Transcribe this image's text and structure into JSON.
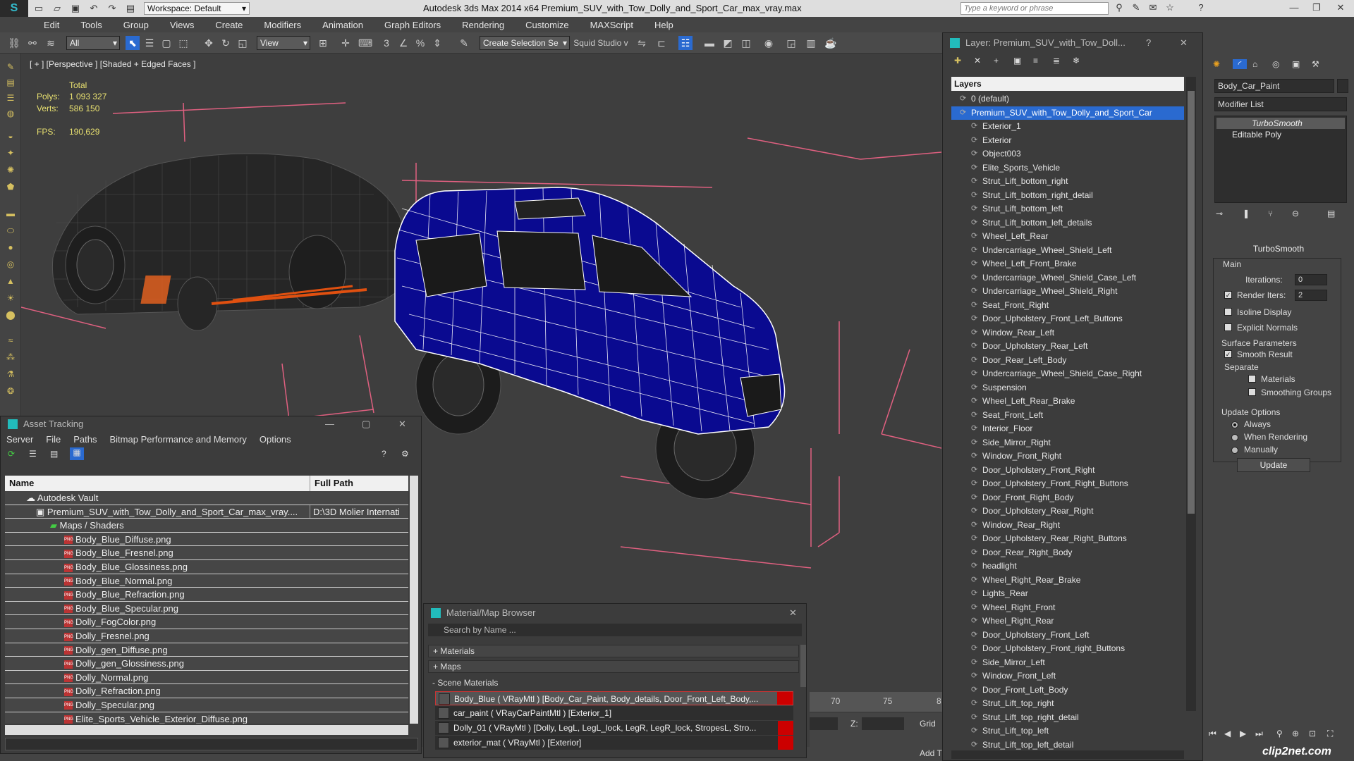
{
  "app": {
    "title": "Autodesk 3ds Max  2014 x64     Premium_SUV_with_Tow_Dolly_and_Sport_Car_max_vray.max",
    "workspace": "Workspace: Default",
    "search_placeholder": "Type a keyword or phrase"
  },
  "menu": [
    "Edit",
    "Tools",
    "Group",
    "Views",
    "Create",
    "Modifiers",
    "Animation",
    "Graph Editors",
    "Rendering",
    "Customize",
    "MAXScript",
    "Help"
  ],
  "toolbar": {
    "filter": "All",
    "refcoord": "View",
    "selection_set": "Create Selection Se",
    "squid": "Squid Studio v"
  },
  "viewport": {
    "label": "[ + ] [Perspective ] [Shaded + Edged Faces ]",
    "stats_header": "Total",
    "polys_label": "Polys:",
    "polys": "1 093 327",
    "verts_label": "Verts:",
    "verts": "586 150",
    "fps_label": "FPS:",
    "fps": "190,629"
  },
  "asset_tracking": {
    "title": "Asset Tracking",
    "menu": [
      "Server",
      "File",
      "Paths",
      "Bitmap Performance and Memory",
      "Options"
    ],
    "col_name": "Name",
    "col_path": "Full Path",
    "vault": "Autodesk Vault",
    "file": "Premium_SUV_with_Tow_Dolly_and_Sport_Car_max_vray....",
    "file_path": "D:\\3D Molier Internati",
    "group": "Maps / Shaders",
    "maps": [
      "Body_Blue_Diffuse.png",
      "Body_Blue_Fresnel.png",
      "Body_Blue_Glossiness.png",
      "Body_Blue_Normal.png",
      "Body_Blue_Refraction.png",
      "Body_Blue_Specular.png",
      "Dolly_FogColor.png",
      "Dolly_Fresnel.png",
      "Dolly_gen_Diffuse.png",
      "Dolly_gen_Glossiness.png",
      "Dolly_Normal.png",
      "Dolly_Refraction.png",
      "Dolly_Specular.png",
      "Elite_Sports_Vehicle_Exterior_Diffuse.png"
    ]
  },
  "material_browser": {
    "title": "Material/Map Browser",
    "search": "Search by Name ...",
    "sections": [
      "+ Materials",
      "+ Maps",
      "- Scene Materials"
    ],
    "materials": [
      "Body_Blue  ( VRayMtl ) [Body_Car_Paint, Body_details, Door_Front_Left_Body,...",
      "car_paint  ( VRayCarPaintMtl ) [Exterior_1]",
      "Dolly_01  ( VRayMtl ) [Dolly, LegL, LegL_lock, LegR, LegR_lock, StropesL, Stro...",
      "exterior_mat  ( VRayMtl ) [Exterior]"
    ]
  },
  "layers": {
    "title": "Layer: Premium_SUV_with_Tow_Doll...",
    "header": "Layers",
    "default_layer": "0 (default)",
    "selected_layer": "Premium_SUV_with_Tow_Dolly_and_Sport_Car",
    "items": [
      "Exterior_1",
      "Exterior",
      "Object003",
      "Elite_Sports_Vehicle",
      "Strut_Lift_bottom_right",
      "Strut_Lift_bottom_right_detail",
      "Strut_Lift_bottom_left",
      "Strut_Lift_bottom_left_details",
      "Wheel_Left_Rear",
      "Undercarriage_Wheel_Shield_Left",
      "Wheel_Left_Front_Brake",
      "Undercarriage_Wheel_Shield_Case_Left",
      "Undercarriage_Wheel_Shield_Right",
      "Seat_Front_Right",
      "Door_Upholstery_Front_Left_Buttons",
      "Window_Rear_Left",
      "Door_Upholstery_Rear_Left",
      "Door_Rear_Left_Body",
      "Undercarriage_Wheel_Shield_Case_Right",
      "Suspension",
      "Wheel_Left_Rear_Brake",
      "Seat_Front_Left",
      "Interior_Floor",
      "Side_Mirror_Right",
      "Window_Front_Right",
      "Door_Upholstery_Front_Right",
      "Door_Upholstery_Front_Right_Buttons",
      "Door_Front_Right_Body",
      "Door_Upholstery_Rear_Right",
      "Window_Rear_Right",
      "Door_Upholstery_Rear_Right_Buttons",
      "Door_Rear_Right_Body",
      "headlight",
      "Wheel_Right_Rear_Brake",
      "Lights_Rear",
      "Wheel_Right_Front",
      "Wheel_Right_Rear",
      "Door_Upholstery_Front_Left",
      "Door_Upholstery_Front_right_Buttons",
      "Side_Mirror_Left",
      "Window_Front_Left",
      "Door_Front_Left_Body",
      "Strut_Lift_top_right",
      "Strut_Lift_top_right_detail",
      "Strut_Lift_top_left",
      "Strut_Lift_top_left_detail"
    ]
  },
  "modifier": {
    "object_name": "Body_Car_Paint",
    "modifier_list": "Modifier List",
    "stack": [
      "TurboSmooth",
      "Editable Poly"
    ],
    "rollout": "TurboSmooth",
    "main": "Main",
    "iterations_label": "Iterations:",
    "iterations": "0",
    "render_iters_label": "Render Iters:",
    "render_iters": "2",
    "isoline": "Isoline Display",
    "explicit": "Explicit Normals",
    "surface_params": "Surface Parameters",
    "smooth_result": "Smooth Result",
    "separate": "Separate",
    "materials": "Materials",
    "smoothing_groups": "Smoothing Groups",
    "update_options": "Update Options",
    "always": "Always",
    "when_rendering": "When Rendering",
    "manually": "Manually",
    "update_button": "Update"
  },
  "timeline": {
    "tick_70": "70",
    "tick_75": "75",
    "tick_80": "8",
    "z_label": "Z:",
    "grid_label": "Grid",
    "add_label": "Add T"
  },
  "watermark": "clip2net.com"
}
